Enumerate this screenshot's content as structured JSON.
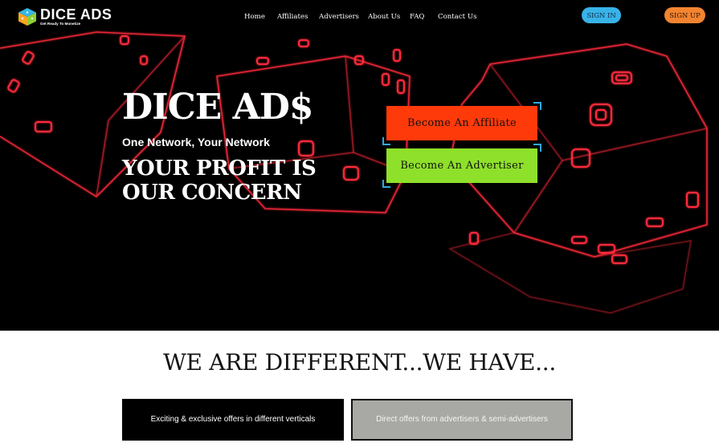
{
  "brand": {
    "name": "DICE ADS",
    "tagline": "Get Ready To Monetize"
  },
  "nav": {
    "items": [
      {
        "label": "Home"
      },
      {
        "label": "Affiliates"
      },
      {
        "label": "Advertisers"
      },
      {
        "label": "About Us"
      },
      {
        "label": "FAQ"
      },
      {
        "label": "Contact Us"
      }
    ],
    "signin_label": "SIGN IN",
    "signup_label": "SIGN UP"
  },
  "hero": {
    "title": "DICE AD$",
    "subtitle": "One Network, Your Network",
    "slogan_line1": "YOUR PROFIT IS",
    "slogan_line2": "OUR CONCERN",
    "cta_affiliate": "Become An Affiliate",
    "cta_advertiser": "Become An Advertiser"
  },
  "features": {
    "heading": "WE ARE DIFFERENT...WE HAVE...",
    "cards": [
      {
        "label": "Exciting & exclusive offers in different verticals"
      },
      {
        "label": "Direct offers from advertisers & semi-advertisers"
      }
    ]
  },
  "colors": {
    "accent_signin": "#38b3e8",
    "accent_signup": "#f28430",
    "cta_affiliate": "#ff3a0a",
    "cta_advertiser": "#8ee02a",
    "neon": "#ff2a3a"
  }
}
